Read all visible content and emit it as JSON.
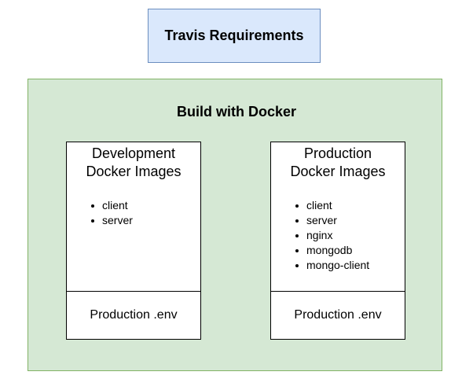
{
  "colors": {
    "travis_fill": "#dae8fc",
    "travis_stroke": "#6c8ebf",
    "build_fill": "#d5e8d4",
    "build_stroke": "#82b366",
    "card_fill": "#ffffff",
    "card_stroke": "#000000"
  },
  "travis": {
    "label": "Travis Requirements"
  },
  "build": {
    "title": "Build with Docker",
    "cards": [
      {
        "title_line1": "Development",
        "title_line2": "Docker Images",
        "items": [
          "client",
          "server"
        ],
        "env_label": "Production .env"
      },
      {
        "title_line1": "Production",
        "title_line2": "Docker Images",
        "items": [
          "client",
          "server",
          "nginx",
          "mongodb",
          "mongo-client"
        ],
        "env_label": "Production .env"
      }
    ]
  }
}
